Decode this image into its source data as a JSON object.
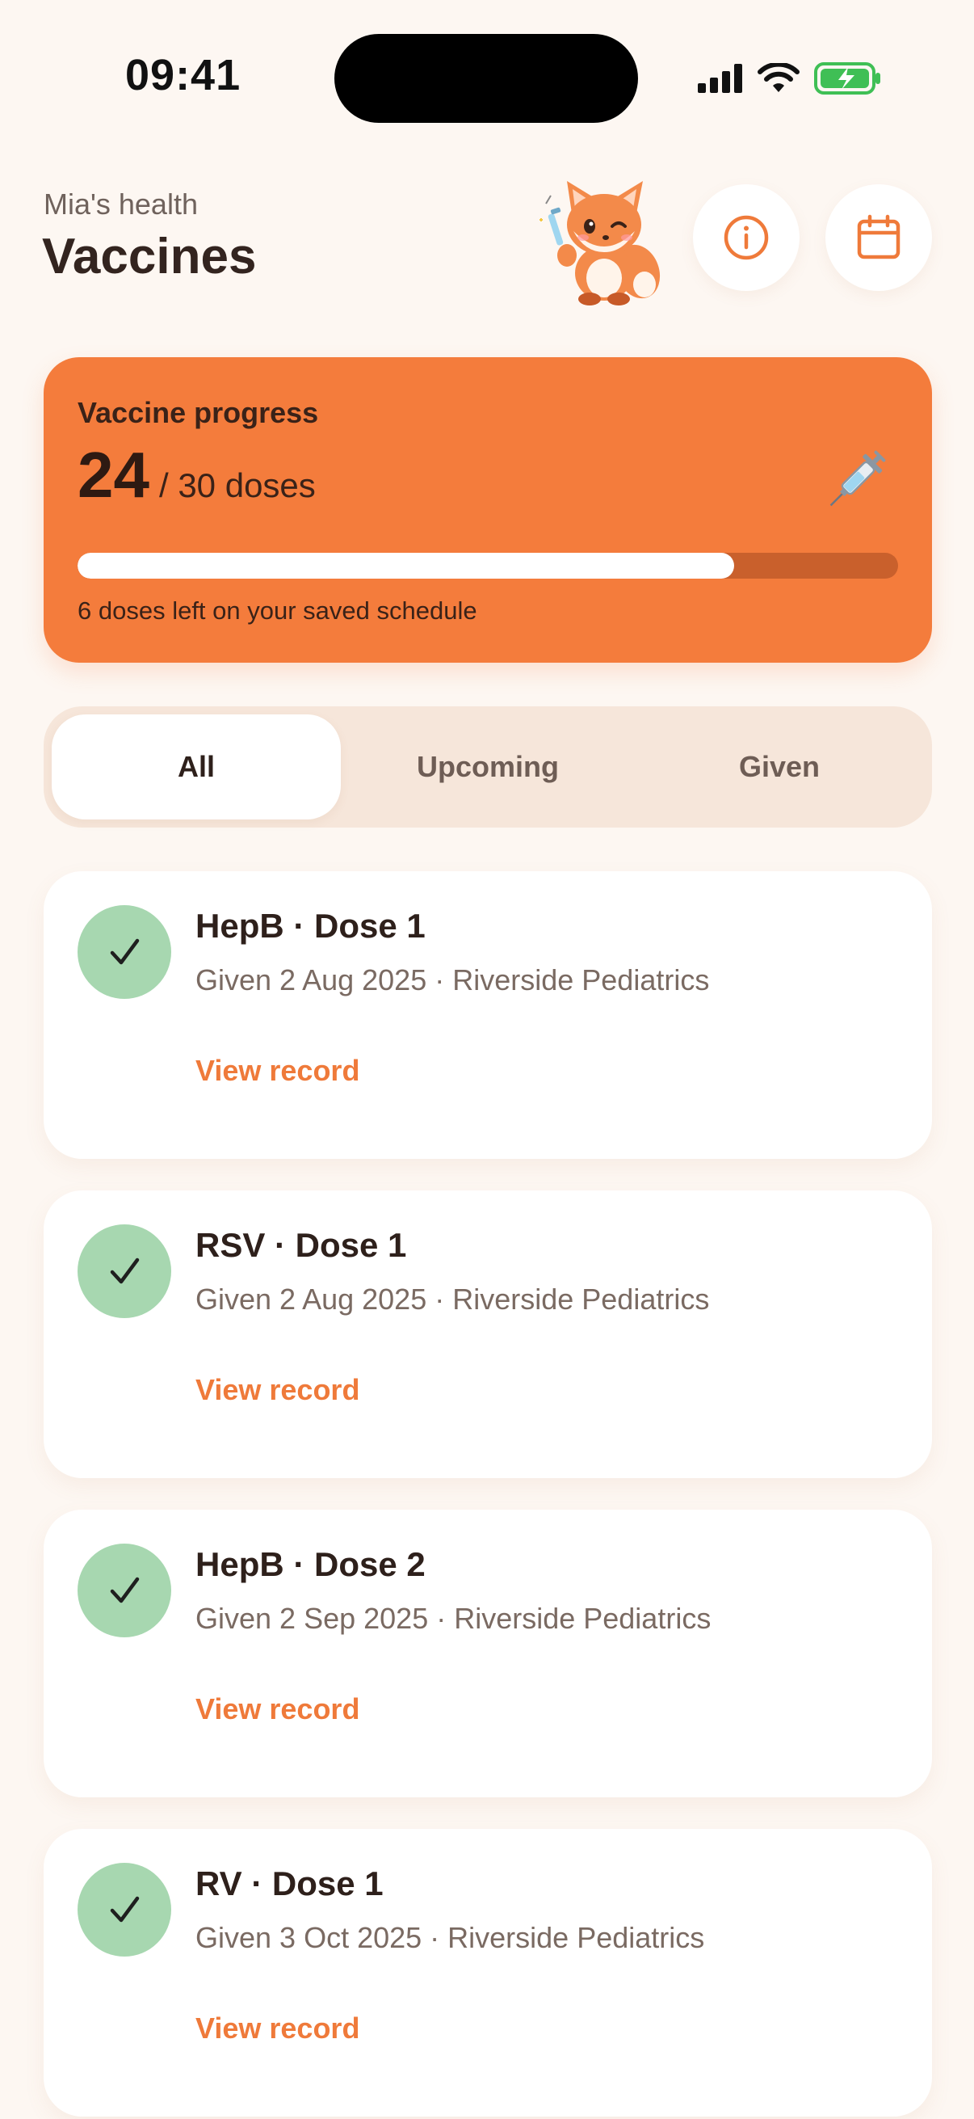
{
  "status_bar": {
    "time": "09:41"
  },
  "header": {
    "subtitle": "Mia's health",
    "title": "Vaccines"
  },
  "icons": {
    "mascot": "fox-mascot-with-syringe",
    "info": "info-icon",
    "calendar": "calendar-icon",
    "check": "checkmark-icon",
    "syringe": "syringe-icon"
  },
  "colors": {
    "accent": "#f47c3c",
    "link": "#ef7a3a",
    "given_badge": "#a7d7b0",
    "background": "#fdf7f2"
  },
  "progress": {
    "label": "Vaccine progress",
    "count": "24",
    "total_text": "/ 30 doses",
    "fraction": 0.8,
    "note": "6 doses left on your saved schedule"
  },
  "tabs": [
    {
      "label": "All",
      "active": true
    },
    {
      "label": "Upcoming",
      "active": false
    },
    {
      "label": "Given",
      "active": false
    }
  ],
  "doses": [
    {
      "title": "HepB · Dose 1",
      "subtitle": "Given 2 Aug 2025 · Riverside Pediatrics",
      "action": "View record"
    },
    {
      "title": "RSV · Dose 1",
      "subtitle": "Given 2 Aug 2025 · Riverside Pediatrics",
      "action": "View record"
    },
    {
      "title": "HepB · Dose 2",
      "subtitle": "Given 2 Sep 2025 · Riverside Pediatrics",
      "action": "View record"
    },
    {
      "title": "RV · Dose 1",
      "subtitle": "Given 3 Oct 2025 · Riverside Pediatrics",
      "action": "View record"
    }
  ]
}
